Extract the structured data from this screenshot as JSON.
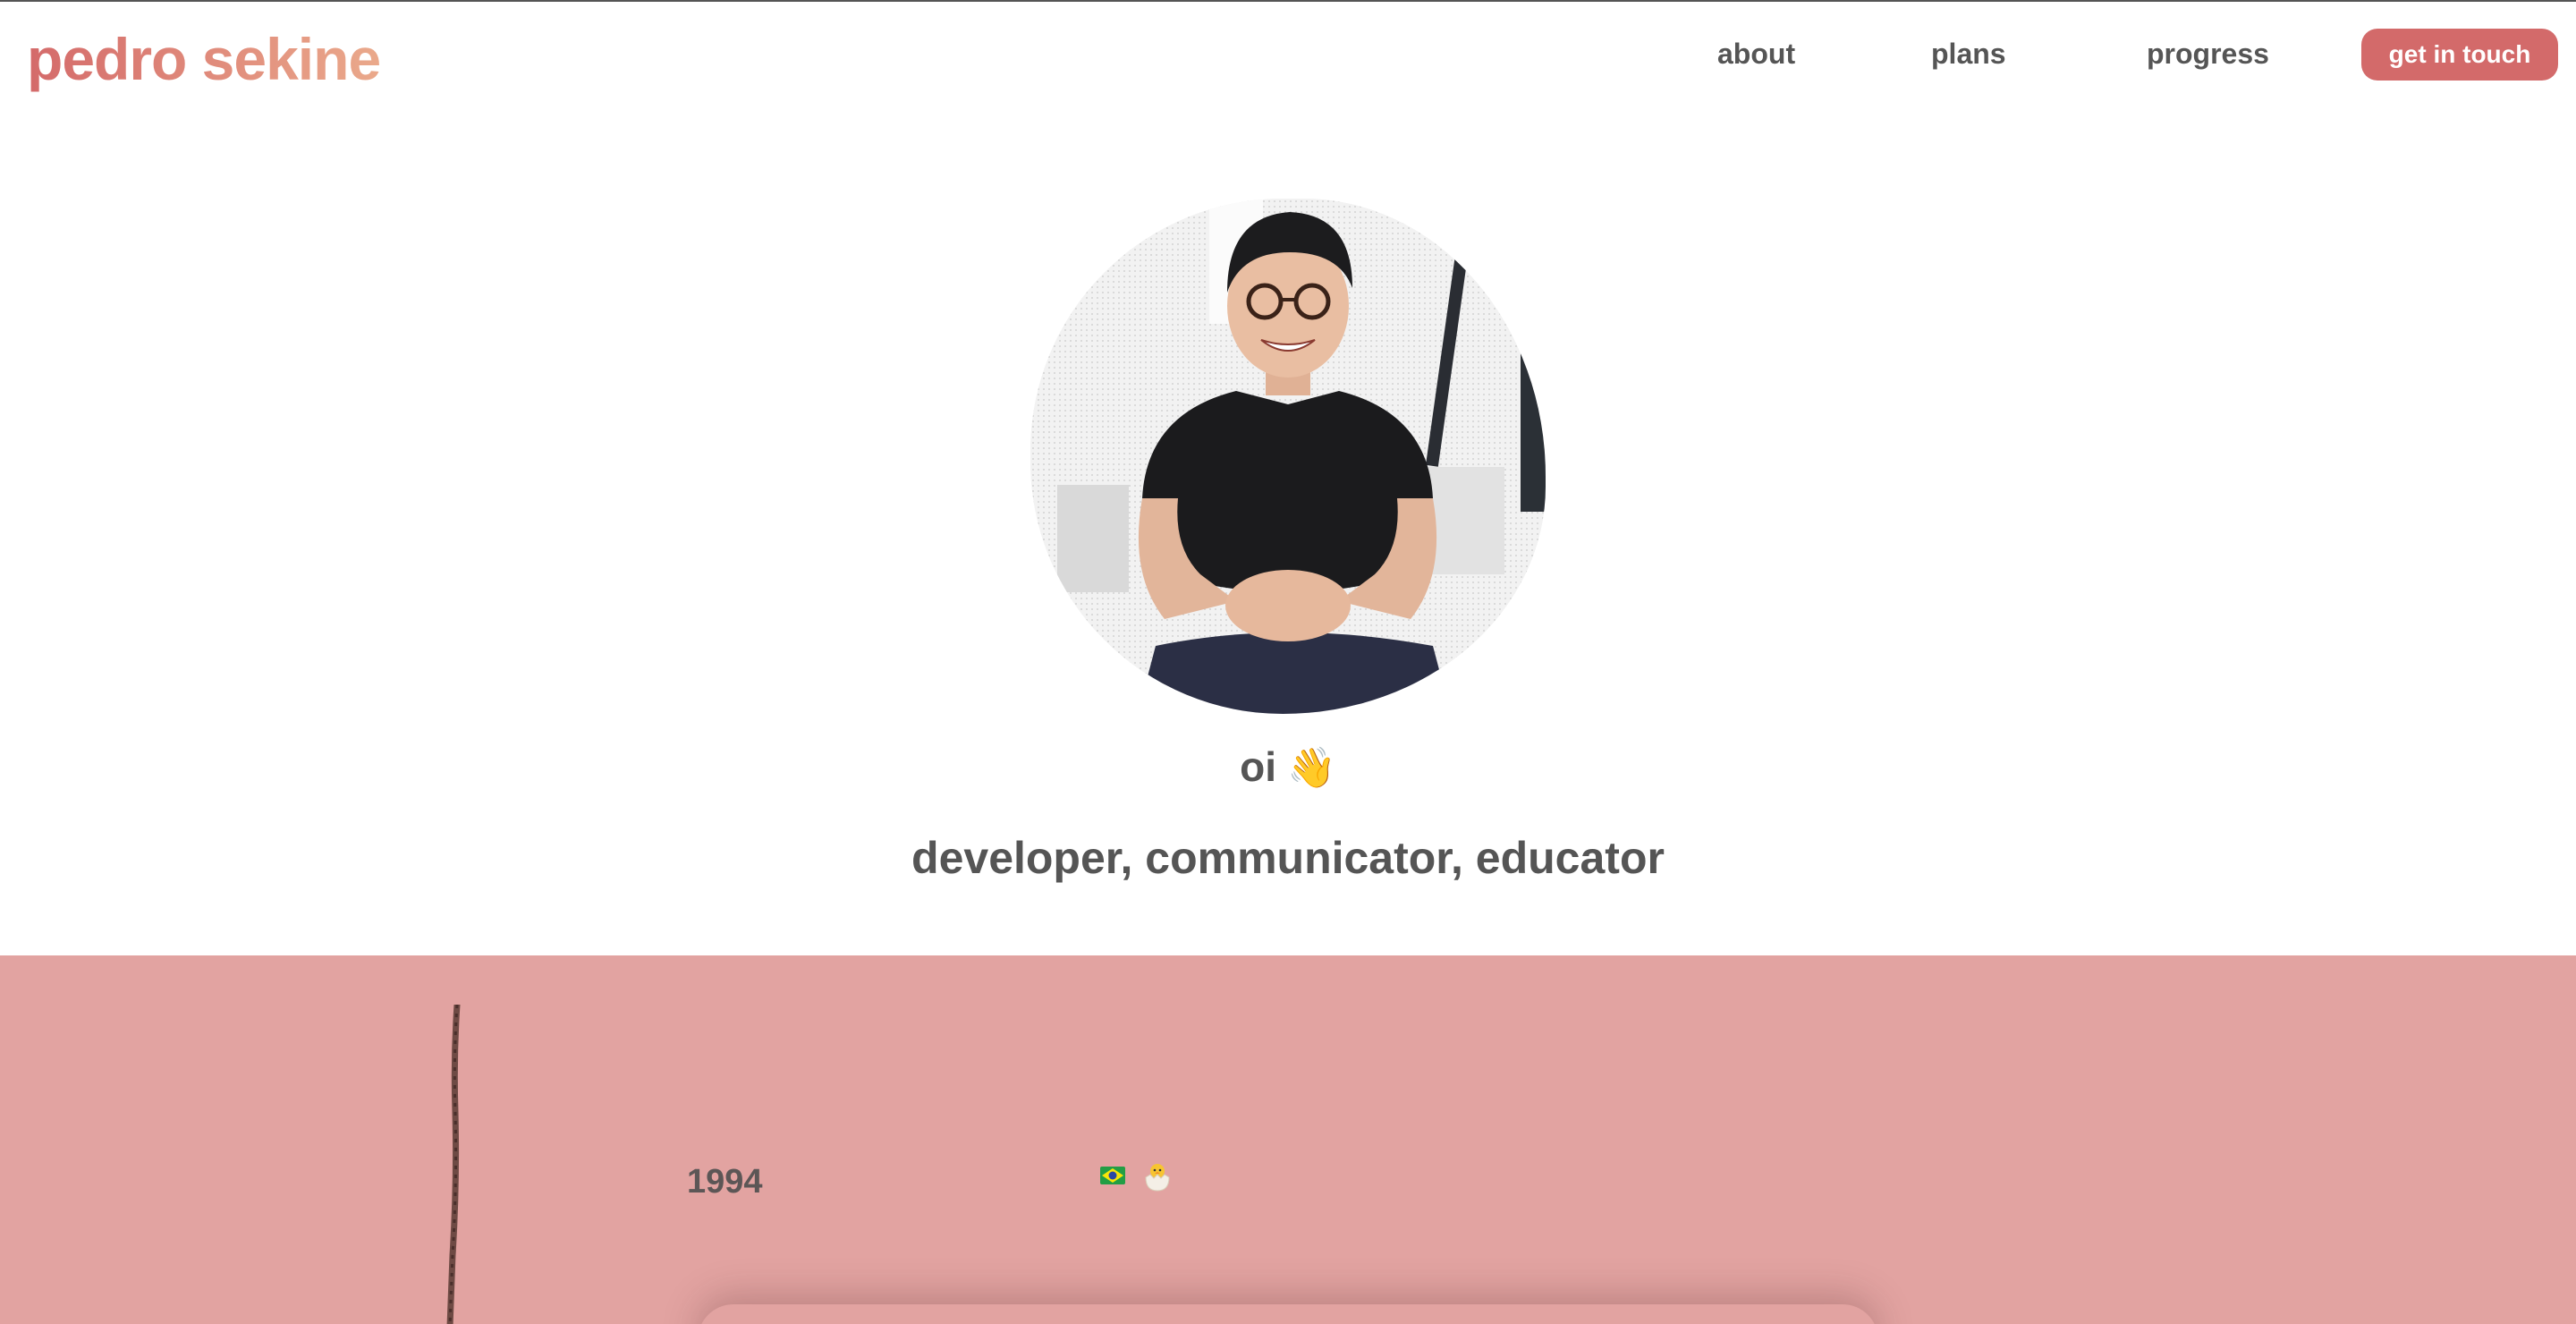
{
  "header": {
    "brand": "pedro sekine",
    "nav": {
      "about": "about",
      "plans": "plans",
      "progress": "progress"
    },
    "cta_label": "get in touch"
  },
  "hero": {
    "greeting": "oi",
    "greeting_emoji": "👋",
    "tagline": "developer, communicator, educator",
    "avatar_icon": "person-photo"
  },
  "timeline": {
    "year": "1994",
    "icons": [
      "brazil-flag-icon",
      "hatching-chick-icon"
    ]
  },
  "colors": {
    "brand_gradient_start": "#d46a6a",
    "brand_gradient_end": "#eaa98b",
    "cta_background": "#d36a6a",
    "nav_text": "#555555",
    "band_background": "#e2a3a1"
  }
}
